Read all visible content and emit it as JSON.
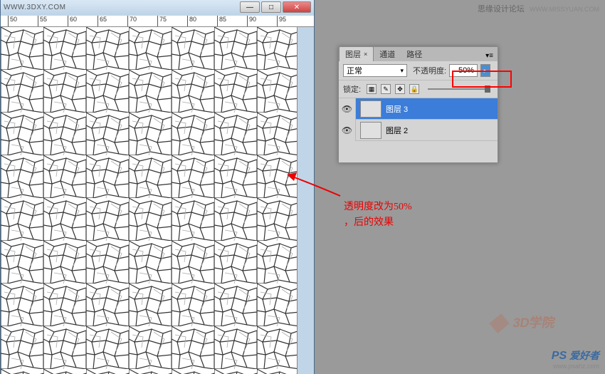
{
  "doc": {
    "title": "WWW.3DXY.COM",
    "ruler_marks": [
      "50",
      "55",
      "60",
      "65",
      "70",
      "75",
      "80",
      "85",
      "90",
      "95"
    ]
  },
  "win_controls": {
    "min": "—",
    "max": "□",
    "close": "✕"
  },
  "panel": {
    "tabs": {
      "layers": "图层",
      "channels": "通道",
      "paths": "路径"
    },
    "blend_mode": "正常",
    "opacity_label": "不透明度:",
    "opacity_value": "50%",
    "lock_label": "锁定:",
    "layers": [
      {
        "name": "图层 3",
        "selected": true
      },
      {
        "name": "图层 2",
        "selected": false
      }
    ]
  },
  "annotation": {
    "line1": "透明度改为50%",
    "line2": "，后的效果"
  },
  "watermarks": {
    "top_text": "思缘设计论坛",
    "top_url": "WWW.MISSYUAN.COM",
    "bottom_text": "爱好者",
    "bottom_ps": "PS",
    "bottom_url": "www.psahz.com",
    "logo_3d": "3D学院"
  }
}
